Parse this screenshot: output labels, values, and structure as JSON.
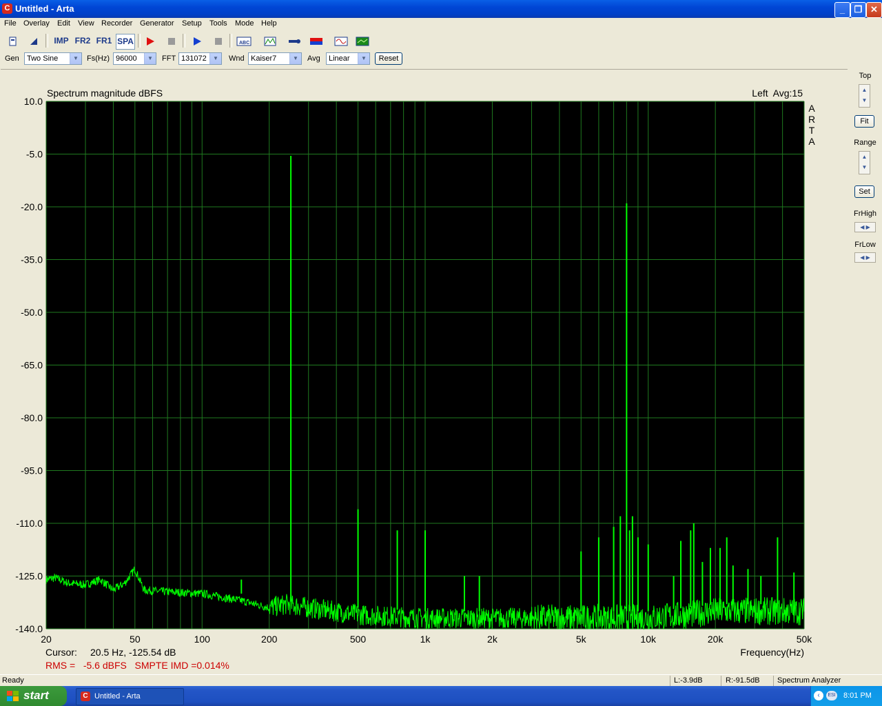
{
  "window": {
    "title": "Untitled - Arta",
    "icon": "arta-app-icon"
  },
  "menu": [
    "File",
    "Overlay",
    "Edit",
    "View",
    "Recorder",
    "Generator",
    "Setup",
    "Tools",
    "Mode",
    "Help"
  ],
  "toolbar": {
    "imp": "IMP",
    "fr2": "FR2",
    "fr1": "FR1",
    "spa": "SPA",
    "icons": [
      "new-icon",
      "open-icon",
      "record-icon",
      "stop-icon",
      "play-icon",
      "stop-gen-icon",
      "text-label-icon",
      "overlay-icon",
      "calibration-icon",
      "color-icon",
      "signal-icon",
      "graph-icon"
    ]
  },
  "controls": {
    "gen_label": "Gen",
    "gen_value": "Two Sine",
    "fs_label": "Fs(Hz)",
    "fs_value": "96000",
    "fft_label": "FFT",
    "fft_value": "131072",
    "wnd_label": "Wnd",
    "wnd_value": "Kaiser7",
    "avg_label": "Avg",
    "avg_value": "Linear",
    "reset_label": "Reset"
  },
  "side": {
    "top_label": "Top",
    "fit_label": "Fit",
    "range_label": "Range",
    "set_label": "Set",
    "frhigh_label": "FrHigh",
    "frlow_label": "FrLow"
  },
  "plot": {
    "title": "Spectrum magnitude dBFS",
    "channel_info": "Left  Avg:15",
    "watermark": [
      "A",
      "R",
      "T",
      "A"
    ],
    "cursor_label": "Cursor:",
    "cursor_value": "20.5 Hz, -125.54 dB",
    "rms_text": "RMS =   -5.6 dBFS   SMPTE IMD =0.014%",
    "xlabel": "Frequency(Hz)"
  },
  "chart_data": {
    "type": "line",
    "title": "Spectrum magnitude dBFS",
    "xlabel": "Frequency(Hz)",
    "ylabel": "",
    "xscale": "log",
    "xlim": [
      20,
      50000
    ],
    "ylim": [
      -140,
      10
    ],
    "yticks": [
      10,
      -5,
      -20,
      -35,
      -50,
      -65,
      -80,
      -95,
      -110,
      -125,
      -140
    ],
    "ytick_labels": [
      "10.0",
      "-5.0",
      "-20.0",
      "-35.0",
      "-50.0",
      "-65.0",
      "-80.0",
      "-95.0",
      "-110.0",
      "-125.0",
      "-140.0"
    ],
    "xticks": [
      20,
      50,
      100,
      200,
      500,
      1000,
      2000,
      5000,
      10000,
      20000,
      50000
    ],
    "xtick_labels": [
      "20",
      "50",
      "100",
      "200",
      "500",
      "1k",
      "2k",
      "5k",
      "10k",
      "20k",
      "50k"
    ],
    "grid": true,
    "background": "#000000",
    "line_color": "#00ff00",
    "grid_color": "#1f7a1f",
    "noise_floor": [
      [
        20,
        -126
      ],
      [
        22,
        -125.5
      ],
      [
        25,
        -127
      ],
      [
        30,
        -127.5
      ],
      [
        35,
        -126
      ],
      [
        40,
        -129
      ],
      [
        45,
        -127
      ],
      [
        50,
        -123
      ],
      [
        55,
        -129
      ],
      [
        70,
        -129.5
      ],
      [
        100,
        -130
      ],
      [
        150,
        -132
      ],
      [
        200,
        -134
      ],
      [
        240,
        -133
      ],
      [
        300,
        -134
      ],
      [
        500,
        -136
      ],
      [
        1000,
        -137
      ],
      [
        2000,
        -137
      ],
      [
        5000,
        -137
      ],
      [
        10000,
        -137
      ],
      [
        15000,
        -136
      ],
      [
        20000,
        -135
      ],
      [
        30000,
        -135
      ],
      [
        50000,
        -135
      ]
    ],
    "peaks": [
      [
        250,
        -5.5
      ],
      [
        8000,
        -19
      ],
      [
        500,
        -106
      ],
      [
        750,
        -112
      ],
      [
        1000,
        -112
      ],
      [
        150,
        -126
      ],
      [
        1500,
        -125
      ],
      [
        1750,
        -125
      ],
      [
        5000,
        -118
      ],
      [
        6000,
        -114
      ],
      [
        7000,
        -111
      ],
      [
        7500,
        -108
      ],
      [
        8250,
        -112
      ],
      [
        8500,
        -108
      ],
      [
        9000,
        -114
      ],
      [
        10000,
        -116
      ],
      [
        13000,
        -125
      ],
      [
        14000,
        -115
      ],
      [
        15500,
        -112
      ],
      [
        16000,
        -110
      ],
      [
        17500,
        -121
      ],
      [
        19000,
        -117
      ],
      [
        21000,
        -117
      ],
      [
        22500,
        -114
      ],
      [
        24000,
        -122
      ],
      [
        28000,
        -123
      ],
      [
        32000,
        -125
      ],
      [
        38000,
        -114
      ],
      [
        45000,
        -124
      ]
    ]
  },
  "status": {
    "ready": "Ready",
    "left_level": "L:-3.9dB",
    "right_level": "R:-91.5dB",
    "mode": "Spectrum Analyzer"
  },
  "taskbar": {
    "start": "start",
    "task": "Untitled - Arta",
    "time": "8:01 PM"
  }
}
